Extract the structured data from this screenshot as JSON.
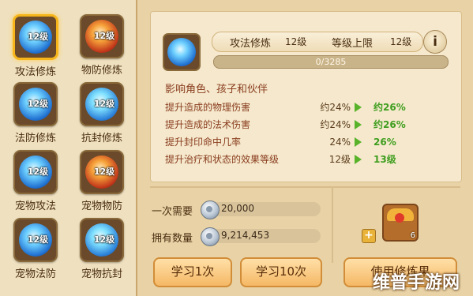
{
  "skills": [
    {
      "label": "攻法修炼",
      "level": "12级",
      "orb": "blue",
      "selected": true
    },
    {
      "label": "物防修炼",
      "level": "12级",
      "orb": "red",
      "selected": false
    },
    {
      "label": "法防修炼",
      "level": "12级",
      "orb": "blue",
      "selected": false
    },
    {
      "label": "抗封修炼",
      "level": "12级",
      "orb": "teal",
      "selected": false
    },
    {
      "label": "宠物攻法",
      "level": "12级",
      "orb": "blue",
      "selected": false
    },
    {
      "label": "宠物物防",
      "level": "12级",
      "orb": "red",
      "selected": false
    },
    {
      "label": "宠物法防",
      "level": "12级",
      "orb": "blue",
      "selected": false
    },
    {
      "label": "宠物抗封",
      "level": "12级",
      "orb": "teal",
      "selected": false
    }
  ],
  "detail": {
    "name": "攻法修炼",
    "level": "12级",
    "max_label": "等级上限",
    "max_level": "12级",
    "info_glyph": "i",
    "exp_text": "0/3285",
    "exp_fraction": 0
  },
  "effects": {
    "title": "影响角色、孩子和伙伴",
    "rows": [
      {
        "name": "提升造成的物理伤害",
        "current": "约24%",
        "next": "约26%"
      },
      {
        "name": "提升造成的法术伤害",
        "current": "约24%",
        "next": "约26%"
      },
      {
        "name": "提升封印命中几率",
        "current": "24%",
        "next": "26%"
      },
      {
        "name": "提升治疗和状态的效果等级",
        "current": "12级",
        "next": "13级"
      }
    ]
  },
  "cost": {
    "need_label": "一次需要",
    "need_value": "20,000",
    "own_label": "拥有数量",
    "own_value": "9,214,453",
    "plus_glyph": "+"
  },
  "buttons": {
    "learn1": "学习1次",
    "learn10": "学习10次",
    "use_item": "使用修炼果"
  },
  "item": {
    "count": "6"
  },
  "watermark": "维普手游网",
  "colors": {
    "accent": "#f6b51a",
    "green": "#58b22a",
    "brown": "#5a3a1a"
  }
}
